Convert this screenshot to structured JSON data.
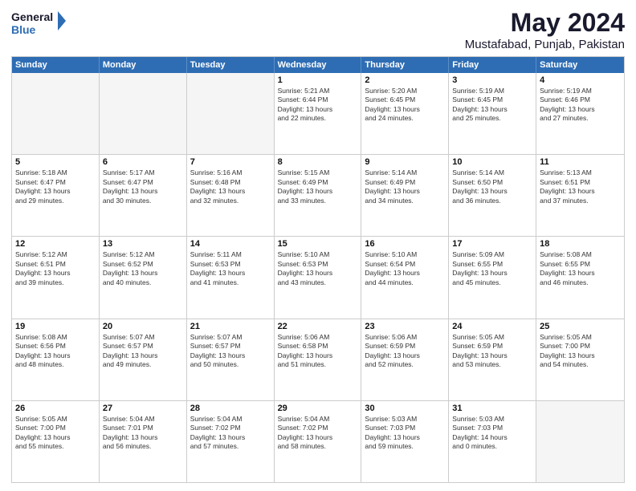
{
  "header": {
    "logo_general": "General",
    "logo_blue": "Blue",
    "main_title": "May 2024",
    "subtitle": "Mustafabad, Punjab, Pakistan"
  },
  "weekdays": [
    "Sunday",
    "Monday",
    "Tuesday",
    "Wednesday",
    "Thursday",
    "Friday",
    "Saturday"
  ],
  "rows": [
    [
      {
        "day": "",
        "lines": []
      },
      {
        "day": "",
        "lines": []
      },
      {
        "day": "",
        "lines": []
      },
      {
        "day": "1",
        "lines": [
          "Sunrise: 5:21 AM",
          "Sunset: 6:44 PM",
          "Daylight: 13 hours",
          "and 22 minutes."
        ]
      },
      {
        "day": "2",
        "lines": [
          "Sunrise: 5:20 AM",
          "Sunset: 6:45 PM",
          "Daylight: 13 hours",
          "and 24 minutes."
        ]
      },
      {
        "day": "3",
        "lines": [
          "Sunrise: 5:19 AM",
          "Sunset: 6:45 PM",
          "Daylight: 13 hours",
          "and 25 minutes."
        ]
      },
      {
        "day": "4",
        "lines": [
          "Sunrise: 5:19 AM",
          "Sunset: 6:46 PM",
          "Daylight: 13 hours",
          "and 27 minutes."
        ]
      }
    ],
    [
      {
        "day": "5",
        "lines": [
          "Sunrise: 5:18 AM",
          "Sunset: 6:47 PM",
          "Daylight: 13 hours",
          "and 29 minutes."
        ]
      },
      {
        "day": "6",
        "lines": [
          "Sunrise: 5:17 AM",
          "Sunset: 6:47 PM",
          "Daylight: 13 hours",
          "and 30 minutes."
        ]
      },
      {
        "day": "7",
        "lines": [
          "Sunrise: 5:16 AM",
          "Sunset: 6:48 PM",
          "Daylight: 13 hours",
          "and 32 minutes."
        ]
      },
      {
        "day": "8",
        "lines": [
          "Sunrise: 5:15 AM",
          "Sunset: 6:49 PM",
          "Daylight: 13 hours",
          "and 33 minutes."
        ]
      },
      {
        "day": "9",
        "lines": [
          "Sunrise: 5:14 AM",
          "Sunset: 6:49 PM",
          "Daylight: 13 hours",
          "and 34 minutes."
        ]
      },
      {
        "day": "10",
        "lines": [
          "Sunrise: 5:14 AM",
          "Sunset: 6:50 PM",
          "Daylight: 13 hours",
          "and 36 minutes."
        ]
      },
      {
        "day": "11",
        "lines": [
          "Sunrise: 5:13 AM",
          "Sunset: 6:51 PM",
          "Daylight: 13 hours",
          "and 37 minutes."
        ]
      }
    ],
    [
      {
        "day": "12",
        "lines": [
          "Sunrise: 5:12 AM",
          "Sunset: 6:51 PM",
          "Daylight: 13 hours",
          "and 39 minutes."
        ]
      },
      {
        "day": "13",
        "lines": [
          "Sunrise: 5:12 AM",
          "Sunset: 6:52 PM",
          "Daylight: 13 hours",
          "and 40 minutes."
        ]
      },
      {
        "day": "14",
        "lines": [
          "Sunrise: 5:11 AM",
          "Sunset: 6:53 PM",
          "Daylight: 13 hours",
          "and 41 minutes."
        ]
      },
      {
        "day": "15",
        "lines": [
          "Sunrise: 5:10 AM",
          "Sunset: 6:53 PM",
          "Daylight: 13 hours",
          "and 43 minutes."
        ]
      },
      {
        "day": "16",
        "lines": [
          "Sunrise: 5:10 AM",
          "Sunset: 6:54 PM",
          "Daylight: 13 hours",
          "and 44 minutes."
        ]
      },
      {
        "day": "17",
        "lines": [
          "Sunrise: 5:09 AM",
          "Sunset: 6:55 PM",
          "Daylight: 13 hours",
          "and 45 minutes."
        ]
      },
      {
        "day": "18",
        "lines": [
          "Sunrise: 5:08 AM",
          "Sunset: 6:55 PM",
          "Daylight: 13 hours",
          "and 46 minutes."
        ]
      }
    ],
    [
      {
        "day": "19",
        "lines": [
          "Sunrise: 5:08 AM",
          "Sunset: 6:56 PM",
          "Daylight: 13 hours",
          "and 48 minutes."
        ]
      },
      {
        "day": "20",
        "lines": [
          "Sunrise: 5:07 AM",
          "Sunset: 6:57 PM",
          "Daylight: 13 hours",
          "and 49 minutes."
        ]
      },
      {
        "day": "21",
        "lines": [
          "Sunrise: 5:07 AM",
          "Sunset: 6:57 PM",
          "Daylight: 13 hours",
          "and 50 minutes."
        ]
      },
      {
        "day": "22",
        "lines": [
          "Sunrise: 5:06 AM",
          "Sunset: 6:58 PM",
          "Daylight: 13 hours",
          "and 51 minutes."
        ]
      },
      {
        "day": "23",
        "lines": [
          "Sunrise: 5:06 AM",
          "Sunset: 6:59 PM",
          "Daylight: 13 hours",
          "and 52 minutes."
        ]
      },
      {
        "day": "24",
        "lines": [
          "Sunrise: 5:05 AM",
          "Sunset: 6:59 PM",
          "Daylight: 13 hours",
          "and 53 minutes."
        ]
      },
      {
        "day": "25",
        "lines": [
          "Sunrise: 5:05 AM",
          "Sunset: 7:00 PM",
          "Daylight: 13 hours",
          "and 54 minutes."
        ]
      }
    ],
    [
      {
        "day": "26",
        "lines": [
          "Sunrise: 5:05 AM",
          "Sunset: 7:00 PM",
          "Daylight: 13 hours",
          "and 55 minutes."
        ]
      },
      {
        "day": "27",
        "lines": [
          "Sunrise: 5:04 AM",
          "Sunset: 7:01 PM",
          "Daylight: 13 hours",
          "and 56 minutes."
        ]
      },
      {
        "day": "28",
        "lines": [
          "Sunrise: 5:04 AM",
          "Sunset: 7:02 PM",
          "Daylight: 13 hours",
          "and 57 minutes."
        ]
      },
      {
        "day": "29",
        "lines": [
          "Sunrise: 5:04 AM",
          "Sunset: 7:02 PM",
          "Daylight: 13 hours",
          "and 58 minutes."
        ]
      },
      {
        "day": "30",
        "lines": [
          "Sunrise: 5:03 AM",
          "Sunset: 7:03 PM",
          "Daylight: 13 hours",
          "and 59 minutes."
        ]
      },
      {
        "day": "31",
        "lines": [
          "Sunrise: 5:03 AM",
          "Sunset: 7:03 PM",
          "Daylight: 14 hours",
          "and 0 minutes."
        ]
      },
      {
        "day": "",
        "lines": []
      }
    ]
  ]
}
